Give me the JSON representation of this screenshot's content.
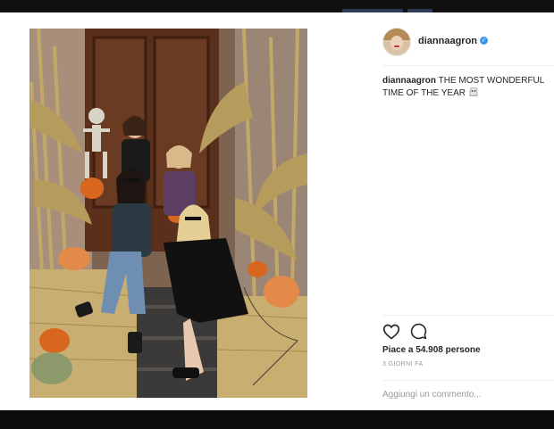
{
  "post": {
    "username": "diannaagron",
    "verified_icon": "verified-badge-icon",
    "caption_user": "diannaagron",
    "caption_text": "THE MOST WONDERFUL TIME OF THE YEAR",
    "caption_emoji": "ghost-emoji-icon",
    "likes": "Piace a 54.908 persone",
    "time_ago": "3 GIORNI FA",
    "comment_placeholder": "Aggiungi un commento..."
  },
  "icons": {
    "like": "heart-icon",
    "comment": "comment-bubble-icon",
    "avatar": "profile-avatar"
  },
  "colors": {
    "verified": "#3897f0",
    "text": "#262626",
    "muted": "#999999",
    "divider": "#efefef",
    "window_frame": "#0b0b0b"
  }
}
